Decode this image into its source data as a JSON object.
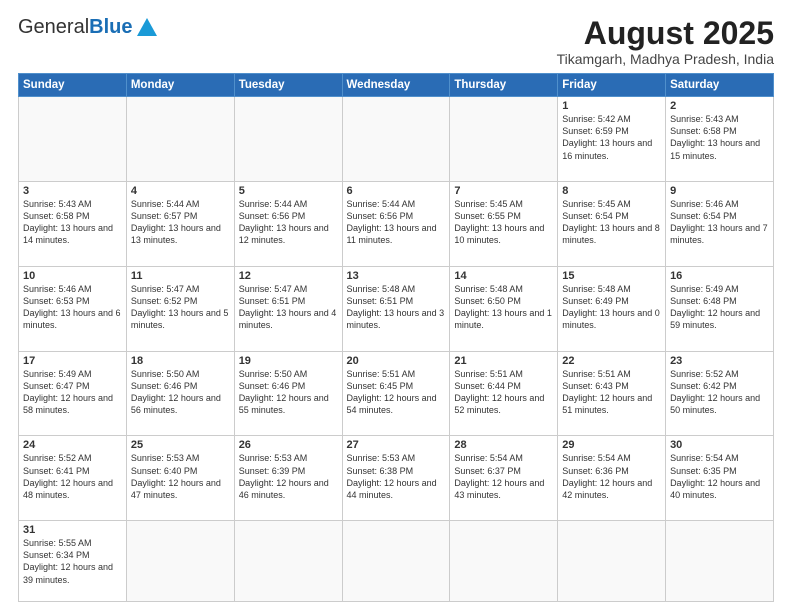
{
  "header": {
    "logo_general": "General",
    "logo_blue": "Blue",
    "month_year": "August 2025",
    "location": "Tikamgarh, Madhya Pradesh, India"
  },
  "days_of_week": [
    "Sunday",
    "Monday",
    "Tuesday",
    "Wednesday",
    "Thursday",
    "Friday",
    "Saturday"
  ],
  "weeks": [
    [
      {
        "day": "",
        "info": ""
      },
      {
        "day": "",
        "info": ""
      },
      {
        "day": "",
        "info": ""
      },
      {
        "day": "",
        "info": ""
      },
      {
        "day": "",
        "info": ""
      },
      {
        "day": "1",
        "info": "Sunrise: 5:42 AM\nSunset: 6:59 PM\nDaylight: 13 hours and 16 minutes."
      },
      {
        "day": "2",
        "info": "Sunrise: 5:43 AM\nSunset: 6:58 PM\nDaylight: 13 hours and 15 minutes."
      }
    ],
    [
      {
        "day": "3",
        "info": "Sunrise: 5:43 AM\nSunset: 6:58 PM\nDaylight: 13 hours and 14 minutes."
      },
      {
        "day": "4",
        "info": "Sunrise: 5:44 AM\nSunset: 6:57 PM\nDaylight: 13 hours and 13 minutes."
      },
      {
        "day": "5",
        "info": "Sunrise: 5:44 AM\nSunset: 6:56 PM\nDaylight: 13 hours and 12 minutes."
      },
      {
        "day": "6",
        "info": "Sunrise: 5:44 AM\nSunset: 6:56 PM\nDaylight: 13 hours and 11 minutes."
      },
      {
        "day": "7",
        "info": "Sunrise: 5:45 AM\nSunset: 6:55 PM\nDaylight: 13 hours and 10 minutes."
      },
      {
        "day": "8",
        "info": "Sunrise: 5:45 AM\nSunset: 6:54 PM\nDaylight: 13 hours and 8 minutes."
      },
      {
        "day": "9",
        "info": "Sunrise: 5:46 AM\nSunset: 6:54 PM\nDaylight: 13 hours and 7 minutes."
      }
    ],
    [
      {
        "day": "10",
        "info": "Sunrise: 5:46 AM\nSunset: 6:53 PM\nDaylight: 13 hours and 6 minutes."
      },
      {
        "day": "11",
        "info": "Sunrise: 5:47 AM\nSunset: 6:52 PM\nDaylight: 13 hours and 5 minutes."
      },
      {
        "day": "12",
        "info": "Sunrise: 5:47 AM\nSunset: 6:51 PM\nDaylight: 13 hours and 4 minutes."
      },
      {
        "day": "13",
        "info": "Sunrise: 5:48 AM\nSunset: 6:51 PM\nDaylight: 13 hours and 3 minutes."
      },
      {
        "day": "14",
        "info": "Sunrise: 5:48 AM\nSunset: 6:50 PM\nDaylight: 13 hours and 1 minute."
      },
      {
        "day": "15",
        "info": "Sunrise: 5:48 AM\nSunset: 6:49 PM\nDaylight: 13 hours and 0 minutes."
      },
      {
        "day": "16",
        "info": "Sunrise: 5:49 AM\nSunset: 6:48 PM\nDaylight: 12 hours and 59 minutes."
      }
    ],
    [
      {
        "day": "17",
        "info": "Sunrise: 5:49 AM\nSunset: 6:47 PM\nDaylight: 12 hours and 58 minutes."
      },
      {
        "day": "18",
        "info": "Sunrise: 5:50 AM\nSunset: 6:46 PM\nDaylight: 12 hours and 56 minutes."
      },
      {
        "day": "19",
        "info": "Sunrise: 5:50 AM\nSunset: 6:46 PM\nDaylight: 12 hours and 55 minutes."
      },
      {
        "day": "20",
        "info": "Sunrise: 5:51 AM\nSunset: 6:45 PM\nDaylight: 12 hours and 54 minutes."
      },
      {
        "day": "21",
        "info": "Sunrise: 5:51 AM\nSunset: 6:44 PM\nDaylight: 12 hours and 52 minutes."
      },
      {
        "day": "22",
        "info": "Sunrise: 5:51 AM\nSunset: 6:43 PM\nDaylight: 12 hours and 51 minutes."
      },
      {
        "day": "23",
        "info": "Sunrise: 5:52 AM\nSunset: 6:42 PM\nDaylight: 12 hours and 50 minutes."
      }
    ],
    [
      {
        "day": "24",
        "info": "Sunrise: 5:52 AM\nSunset: 6:41 PM\nDaylight: 12 hours and 48 minutes."
      },
      {
        "day": "25",
        "info": "Sunrise: 5:53 AM\nSunset: 6:40 PM\nDaylight: 12 hours and 47 minutes."
      },
      {
        "day": "26",
        "info": "Sunrise: 5:53 AM\nSunset: 6:39 PM\nDaylight: 12 hours and 46 minutes."
      },
      {
        "day": "27",
        "info": "Sunrise: 5:53 AM\nSunset: 6:38 PM\nDaylight: 12 hours and 44 minutes."
      },
      {
        "day": "28",
        "info": "Sunrise: 5:54 AM\nSunset: 6:37 PM\nDaylight: 12 hours and 43 minutes."
      },
      {
        "day": "29",
        "info": "Sunrise: 5:54 AM\nSunset: 6:36 PM\nDaylight: 12 hours and 42 minutes."
      },
      {
        "day": "30",
        "info": "Sunrise: 5:54 AM\nSunset: 6:35 PM\nDaylight: 12 hours and 40 minutes."
      }
    ],
    [
      {
        "day": "31",
        "info": "Sunrise: 5:55 AM\nSunset: 6:34 PM\nDaylight: 12 hours and 39 minutes."
      },
      {
        "day": "",
        "info": ""
      },
      {
        "day": "",
        "info": ""
      },
      {
        "day": "",
        "info": ""
      },
      {
        "day": "",
        "info": ""
      },
      {
        "day": "",
        "info": ""
      },
      {
        "day": "",
        "info": ""
      }
    ]
  ]
}
